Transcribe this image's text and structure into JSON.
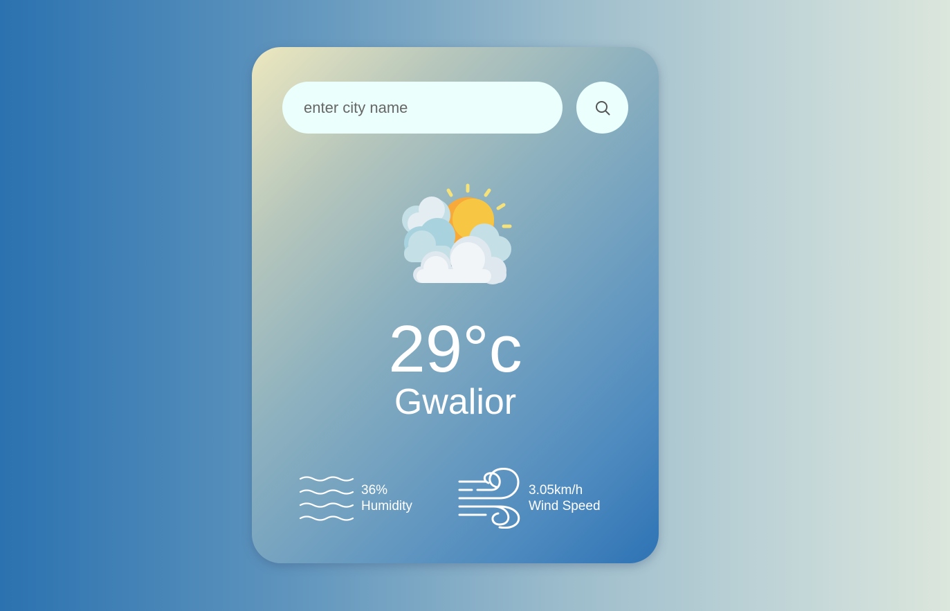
{
  "search": {
    "placeholder": "enter city name",
    "value": ""
  },
  "weather": {
    "icon": "partly-cloudy-sun-icon",
    "temperature": "29°c",
    "city": "Gwalior"
  },
  "details": {
    "humidity": {
      "icon": "humidity-waves-icon",
      "value": "36%",
      "label": "Humidity"
    },
    "wind": {
      "icon": "wind-icon",
      "value": "3.05km/h",
      "label": "Wind Speed"
    }
  },
  "colors": {
    "card_gradient_start": "#ede8bf",
    "card_gradient_end": "#2e73b5",
    "input_background": "#ebfffc",
    "text": "#ffffff",
    "sun": "#f7c743"
  }
}
